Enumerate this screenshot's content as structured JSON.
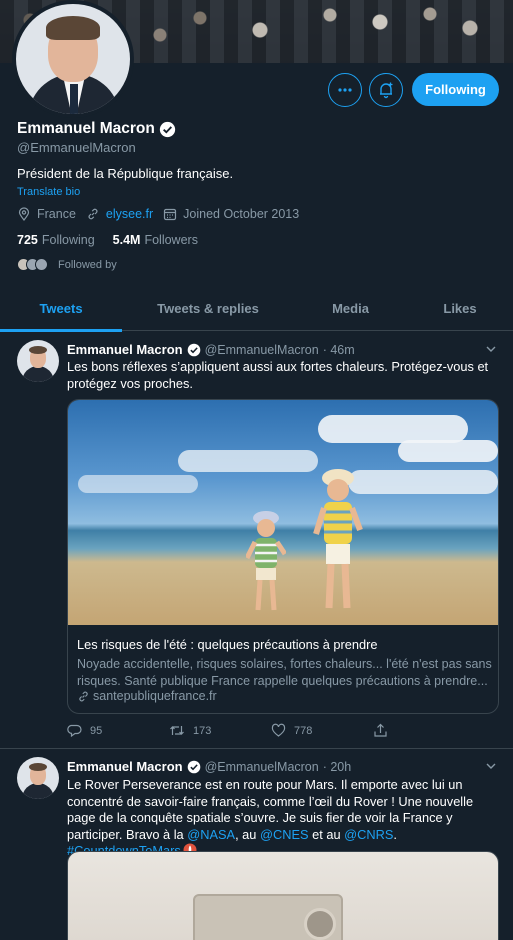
{
  "profile": {
    "name": "Emmanuel Macron",
    "handle": "@EmmanuelMacron",
    "bio": "Président de la République française.",
    "translate_bio": "Translate bio",
    "location": "France",
    "website": "elysee.fr",
    "joined": "Joined October 2013",
    "following_count": "725",
    "following_label": "Following",
    "followers_count": "5.4M",
    "followers_label": "Followers",
    "followed_by_label": "Followed by",
    "follow_button": "Following"
  },
  "tabs": [
    {
      "label": "Tweets",
      "active": true
    },
    {
      "label": "Tweets & replies",
      "active": false
    },
    {
      "label": "Media",
      "active": false
    },
    {
      "label": "Likes",
      "active": false
    }
  ],
  "tweets": [
    {
      "author": "Emmanuel Macron",
      "handle": "@EmmanuelMacron",
      "time": "· 46m",
      "text": "Les bons réflexes s’appliquent aussi aux fortes chaleurs. Protégez-vous et protégez vos proches.",
      "card": {
        "title": "Les risques de l'été : quelques précautions à prendre",
        "description": "Noyade accidentelle, risques solaires, fortes chaleurs... l'été n'est pas sans risques. Santé publique France rappelle quelques précautions à prendre...",
        "domain": "santepubliquefrance.fr"
      },
      "replies": "95",
      "retweets": "173",
      "likes": "778"
    },
    {
      "author": "Emmanuel Macron",
      "handle": "@EmmanuelMacron",
      "time": "· 20h",
      "text_plain": "Le Rover Perseverance est en route pour Mars. Il emporte avec lui un concentré de savoir-faire français, comme l’œil du Rover ! Une nouvelle page de la conquête spatiale s’ouvre. Je suis fier de voir la France y participer. Bravo à la",
      "mention_nasa": "@NASA",
      "sep1": ", au",
      "mention_cnes": "@CNES",
      "sep2": "et au",
      "mention_cnrs": "@CNRS",
      "sep3": ".",
      "hashtag": "#CountdownToMars"
    }
  ],
  "colors": {
    "background": "#15202b",
    "accent": "#1da1f2",
    "muted": "#8899a6",
    "border": "#38444d"
  }
}
